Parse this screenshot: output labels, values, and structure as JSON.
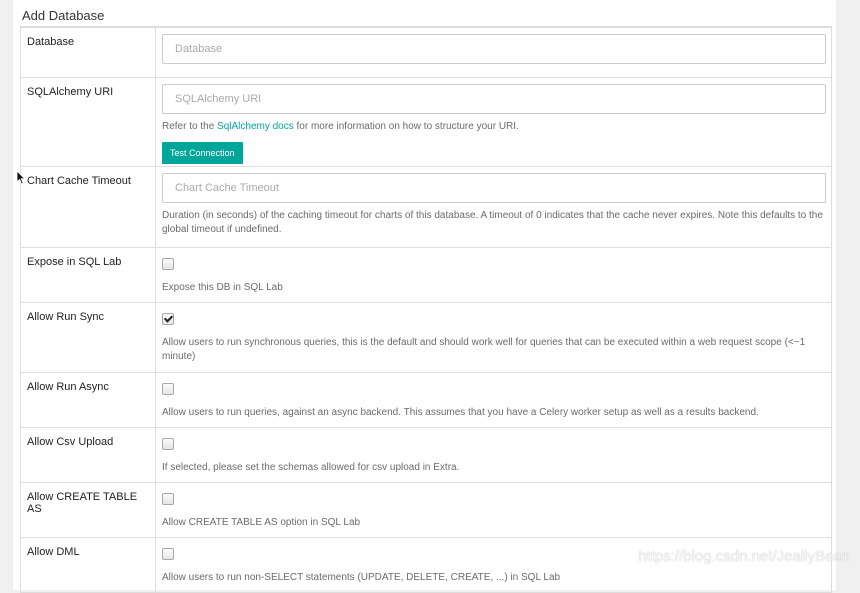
{
  "panel": {
    "title": "Add Database"
  },
  "fields": {
    "database": {
      "label": "Database",
      "placeholder": "Database",
      "value": ""
    },
    "sqlalchemy_uri": {
      "label": "SQLAlchemy URI",
      "placeholder": "SQLAlchemy URI",
      "value": "",
      "help_prefix": "Refer to the ",
      "help_link": "SqlAlchemy docs",
      "help_suffix": " for more information on how to structure your URI.",
      "button_label": "Test Connection"
    },
    "chart_cache_timeout": {
      "label": "Chart Cache Timeout",
      "placeholder": "Chart Cache Timeout",
      "value": "",
      "help": "Duration (in seconds) of the caching timeout for charts of this database. A timeout of 0 indicates that the cache never expires. Note this defaults to the global timeout if undefined."
    },
    "expose_in_sqllab": {
      "label": "Expose in SQL Lab",
      "checked": false,
      "help": "Expose this DB in SQL Lab"
    },
    "allow_run_sync": {
      "label": "Allow Run Sync",
      "checked": true,
      "help": "Allow users to run synchronous queries, this is the default and should work well for queries that can be executed within a web request scope (<~1 minute)"
    },
    "allow_run_async": {
      "label": "Allow Run Async",
      "checked": false,
      "help": "Allow users to run queries, against an async backend. This assumes that you have a Celery worker setup as well as a results backend."
    },
    "allow_csv_upload": {
      "label": "Allow Csv Upload",
      "checked": false,
      "help": "If selected, please set the schemas allowed for csv upload in Extra."
    },
    "allow_ctas": {
      "label": "Allow CREATE TABLE AS",
      "checked": false,
      "help": "Allow CREATE TABLE AS option in SQL Lab"
    },
    "allow_dml": {
      "label": "Allow DML",
      "checked": false,
      "help": "Allow users to run non-SELECT statements (UPDATE, DELETE, CREATE, ...) in SQL Lab"
    }
  },
  "watermark": "https://blog.csdn.net/JeallyBean",
  "colors": {
    "accent": "#00a699",
    "border": "#dddddd",
    "help_text": "#6b6b6b"
  },
  "icons": {
    "cursor": "mouse-pointer-icon",
    "check": "checkmark-icon"
  }
}
